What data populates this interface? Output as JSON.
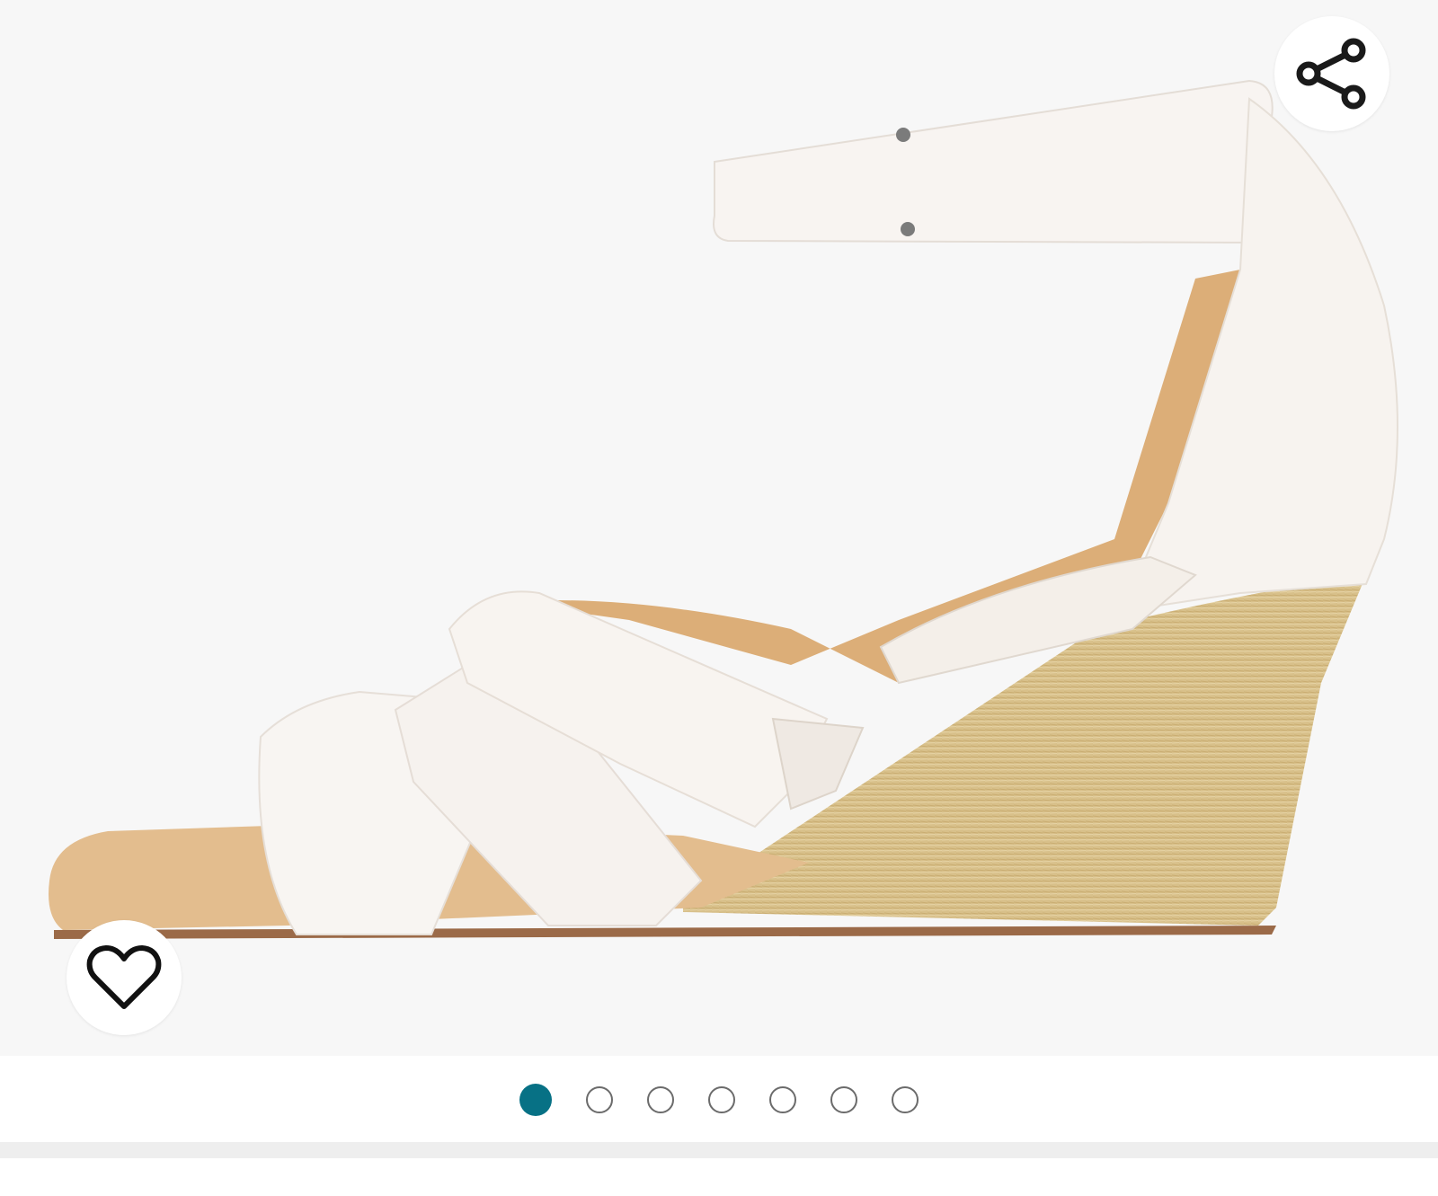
{
  "product_gallery": {
    "image_description_icon": "sandal-image",
    "share_icon": "share-icon",
    "favorite_icon": "heart-outline-icon",
    "carousel": {
      "total_images": 7,
      "active_index": 0,
      "active_color": "#077185",
      "inactive_color": "#ffffff"
    }
  }
}
